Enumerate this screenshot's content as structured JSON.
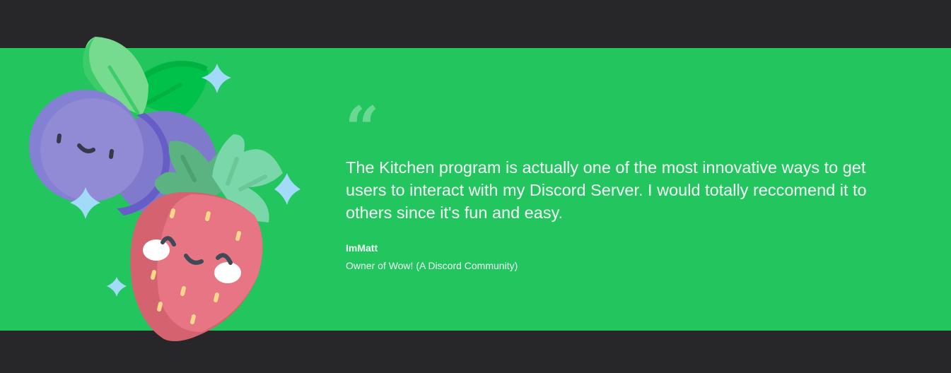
{
  "testimonial": {
    "quote_mark": "“",
    "quote": "The Kitchen program is actually one of the most innovative ways to get users to interact with my Discord Server. I would totally reccomend it to others since it's fun and easy.",
    "author_name": "ImMatt",
    "author_role": "Owner of Wow! (A Discord Community)"
  },
  "colors": {
    "background": "#27272a",
    "band": "#23c55e",
    "text": "#f7fff9"
  },
  "illustration": {
    "icons": [
      "blueberry-icon",
      "strawberry-icon",
      "sparkle-icon"
    ]
  }
}
